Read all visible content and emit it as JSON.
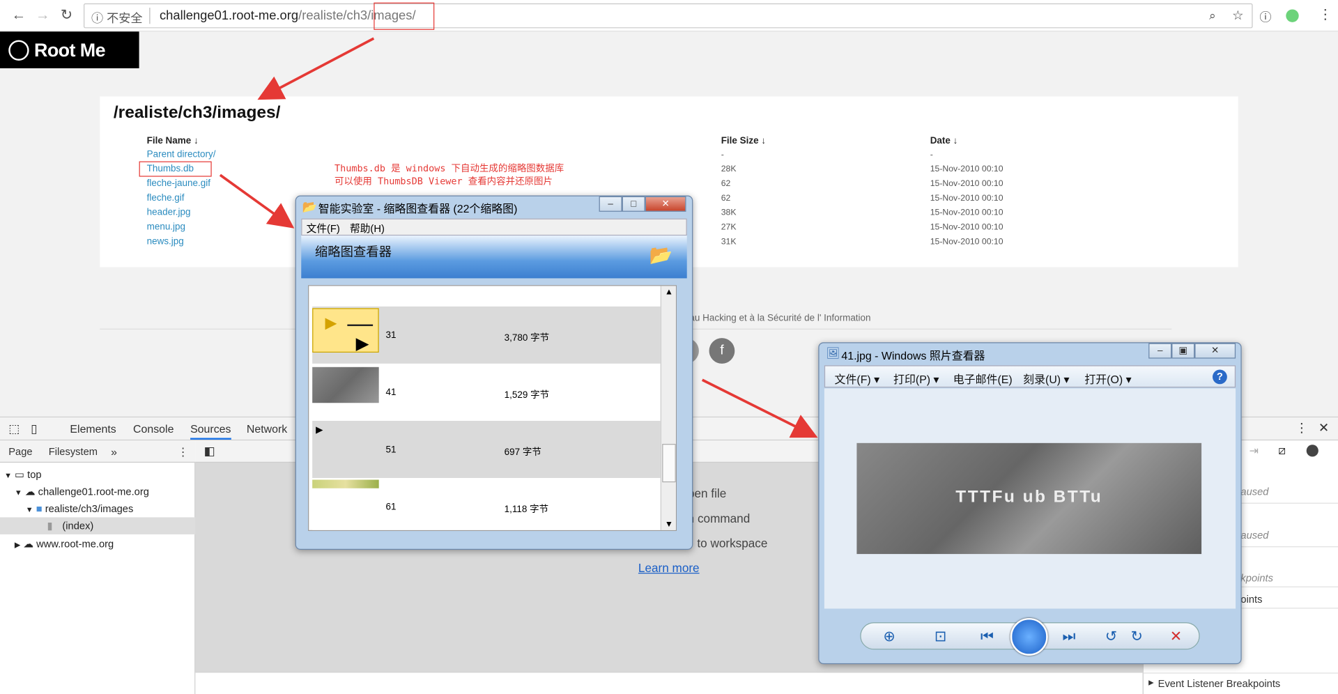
{
  "browser": {
    "insecure_label": "不安全",
    "url_host": "challenge01.root-me.org",
    "url_path": "/realiste/ch3/images/"
  },
  "site": {
    "logo_text": "Root Me"
  },
  "listing": {
    "title": "/realiste/ch3/images/",
    "col_name": "File Name ↓",
    "col_size": "File Size ↓",
    "col_date": "Date ↓",
    "rows": [
      {
        "name": "Parent directory/",
        "size": "-",
        "date": "-"
      },
      {
        "name": "Thumbs.db",
        "size": "28K",
        "date": "15-Nov-2010 00:10"
      },
      {
        "name": "fleche-jaune.gif",
        "size": "62",
        "date": "15-Nov-2010 00:10"
      },
      {
        "name": "fleche.gif",
        "size": "62",
        "date": "15-Nov-2010 00:10"
      },
      {
        "name": "header.jpg",
        "size": "38K",
        "date": "15-Nov-2010 00:10"
      },
      {
        "name": "menu.jpg",
        "size": "27K",
        "date": "15-Nov-2010 00:10"
      },
      {
        "name": "news.jpg",
        "size": "31K",
        "date": "15-Nov-2010 00:10"
      }
    ]
  },
  "annotation": {
    "line1": "Thumbs.db 是 windows 下自动生成的缩略图数据库",
    "line2": "可以使用 ThumbsDB Viewer 查看内容并还原图片"
  },
  "footer": {
    "text": "au Hacking et à la Sécurité de l'  Information",
    "social_icon": "f"
  },
  "devtools": {
    "tabs": [
      "Elements",
      "Console",
      "Sources",
      "Network"
    ],
    "active_tab": "Sources",
    "subtabs": [
      "Page",
      "Filesystem"
    ],
    "tree": {
      "top": "top",
      "host1": "challenge01.root-me.org",
      "folder": "realiste/ch3/images",
      "file": "(index)",
      "host2": "www.root-me.org"
    },
    "hints": {
      "open_file": "pen file",
      "run_command": "un command",
      "workspace": "to workspace",
      "learn_more": "Learn more"
    },
    "right": {
      "paused1": "aused",
      "paused2": "aused",
      "breakpoints": "kpoints",
      "points": "oints",
      "event_listener": "Event Listener Breakpoints"
    }
  },
  "thumbs_viewer": {
    "title": "智能实验室 - 缩略图查看器 (22个缩略图)",
    "menu": [
      "文件(F)",
      "帮助(H)"
    ],
    "header": "缩略图查看器",
    "items": [
      {
        "name": "31",
        "size": "3,780 字节"
      },
      {
        "name": "41",
        "size": "1,529 字节"
      },
      {
        "name": "51",
        "size": "697 字节"
      },
      {
        "name": "61",
        "size": "1,118 字节"
      }
    ]
  },
  "photo_viewer": {
    "title": "41.jpg - Windows 照片查看器",
    "menu": [
      "文件(F)",
      "打印(P)",
      "电子邮件(E)",
      "刻录(U)",
      "打开(O)"
    ],
    "image_text": "TTTFu ub BTTu"
  },
  "colors": {
    "accent_red": "#e53935",
    "link_blue": "#2a8bbf"
  }
}
